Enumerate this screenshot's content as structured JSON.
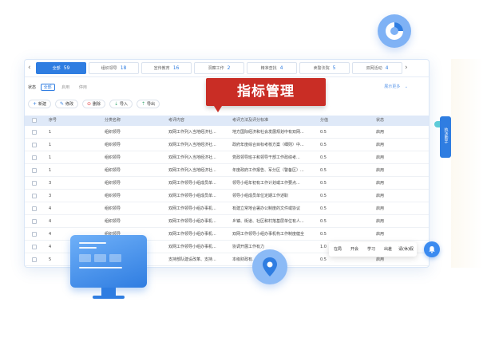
{
  "tabs": [
    {
      "label": "全部",
      "count": "59",
      "active": true
    },
    {
      "label": "组织领导",
      "count": "18",
      "active": false
    },
    {
      "label": "宣传教育",
      "count": "16",
      "active": false
    },
    {
      "label": "洞察工作",
      "count": "2",
      "active": false
    },
    {
      "label": "精准查找",
      "count": "4",
      "active": false
    },
    {
      "label": "卖警法院",
      "count": "5",
      "active": false
    },
    {
      "label": "双网活动",
      "count": "4",
      "active": false
    }
  ],
  "filter": {
    "label": "状态",
    "options": [
      "全部",
      "启用",
      "停用"
    ],
    "show_more": "展示更多"
  },
  "toolbar": {
    "add": "新建",
    "edit": "修改",
    "delete": "删除",
    "import": "导入",
    "export": "导出"
  },
  "banner": "指标管理",
  "table": {
    "headers": [
      "序号",
      "分类名称",
      "考评内容",
      "考评方法及评分标准",
      "分值",
      "状态"
    ],
    "rows": [
      [
        "1",
        "组织领导",
        "双网工作列入当地经济社...",
        "地方国际经济和社会发展规划中有双网...",
        "0.5",
        "启用"
      ],
      [
        "1",
        "组织领导",
        "双网工作列入当地经济社...",
        "政府年度综合目标考核方案（细则）中...",
        "0.5",
        "启用"
      ],
      [
        "1",
        "组织领导",
        "双网工作列入当地经济社...",
        "党政领导班子和领导干部工作政绩考...",
        "0.5",
        "启用"
      ],
      [
        "1",
        "组织领导",
        "双网工作列入当地经济社...",
        "年度政府工作报告、军分区（警备区）...",
        "0.5",
        "启用"
      ],
      [
        "3",
        "组织领导",
        "双网工作领导小组成员单...",
        "领导小组年初有工作计划或工作要点...",
        "0.5",
        "启用"
      ],
      [
        "3",
        "组织领导",
        "双网工作领导小组成员单...",
        "领导小组成员单位定期工作述职",
        "0.5",
        "启用"
      ],
      [
        "4",
        "组织领导",
        "双网工作领导小组办事机...",
        "有建立常地合署办公制度的文件或协议",
        "0.5",
        "启用"
      ],
      [
        "4",
        "组织领导",
        "双网工作领导小组办事机...",
        "乡镇、街道、社区和村落基层单位有人...",
        "0.5",
        "启用"
      ],
      [
        "4",
        "组织领导",
        "双网工作领导小组办事机...",
        "双网工作领导小组办事机构工作制度健全",
        "0.5",
        "启用"
      ],
      [
        "4",
        "组织领导",
        "双网工作领导小组办事机...",
        "协调开展工作有力",
        "1.0",
        "启用"
      ],
      [
        "5",
        "组织领导",
        "支持部队建设改革、支持...",
        "本级财政有...",
        "0.5",
        "启用"
      ]
    ]
  },
  "side_assistant": "执法助手",
  "quickbar": [
    "在局",
    "开会",
    "学习",
    "出差",
    "请(休)假"
  ]
}
